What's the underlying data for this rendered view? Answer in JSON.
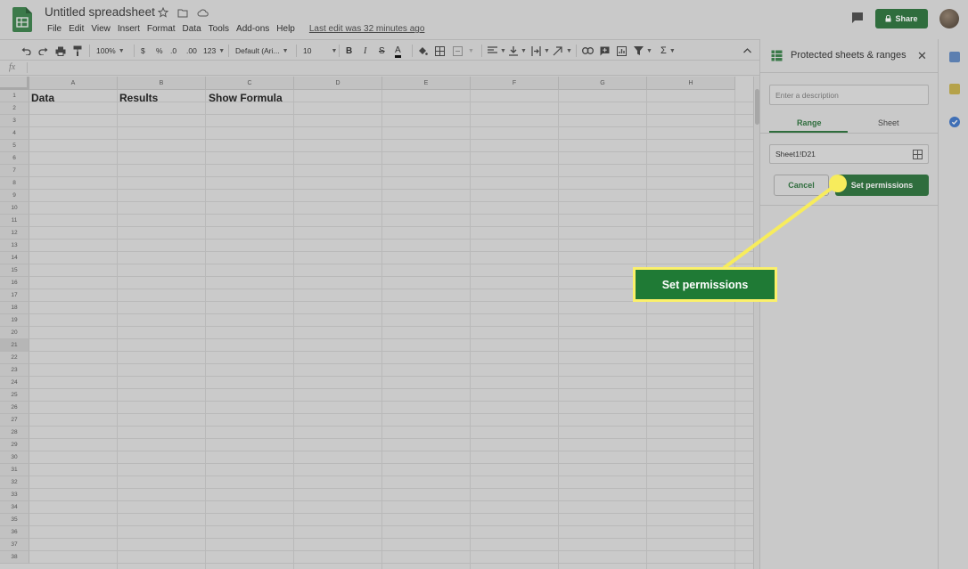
{
  "titlebar": {
    "doc_title": "Untitled spreadsheet",
    "menu": [
      "File",
      "Edit",
      "View",
      "Insert",
      "Format",
      "Data",
      "Tools",
      "Add-ons",
      "Help"
    ],
    "last_edit": "Last edit was 32 minutes ago",
    "share_label": "Share",
    "icons": [
      "sheets-logo-icon",
      "star-icon",
      "folder-move-icon",
      "cloud-status-icon",
      "comment-icon",
      "lock-icon"
    ]
  },
  "toolbar": {
    "zoom": "100%",
    "currency": "$",
    "percent": "%",
    "decimal_decrease": ".0",
    "decimal_increase": ".00",
    "more_formats": "123",
    "font": "Default (Ari...",
    "font_size": "10",
    "bold": "B",
    "italic": "I",
    "strike": "S",
    "text_color": "A",
    "sigma": "Σ"
  },
  "formula_bar": {
    "fx": "fx",
    "value": ""
  },
  "grid": {
    "columns": [
      "A",
      "B",
      "C",
      "D",
      "E",
      "F",
      "G",
      "H"
    ],
    "rows": [
      "1",
      "2",
      "3",
      "4",
      "5",
      "6",
      "7",
      "8",
      "9",
      "10",
      "11",
      "12",
      "13",
      "14",
      "15",
      "16",
      "17",
      "18",
      "19",
      "20",
      "21",
      "22",
      "23",
      "24",
      "25",
      "26",
      "27",
      "28",
      "29",
      "30",
      "31",
      "32",
      "33",
      "34",
      "35",
      "36",
      "37",
      "38"
    ],
    "selected_row": "21",
    "cells": {
      "A1": "Data",
      "B1": "Results",
      "C1": "Show Formula"
    }
  },
  "panel": {
    "title": "Protected sheets & ranges",
    "description_placeholder": "Enter a description",
    "tab_range": "Range",
    "tab_sheet": "Sheet",
    "range_value": "Sheet1!D21",
    "cancel_label": "Cancel",
    "set_permissions_label": "Set permissions"
  },
  "callout": {
    "label": "Set permissions"
  },
  "colors": {
    "accent_green": "#2f6d3d",
    "callout_yellow": "#fbf06a",
    "callout_green": "#1f7a35",
    "overlay_gray": "#c8c8c8"
  }
}
